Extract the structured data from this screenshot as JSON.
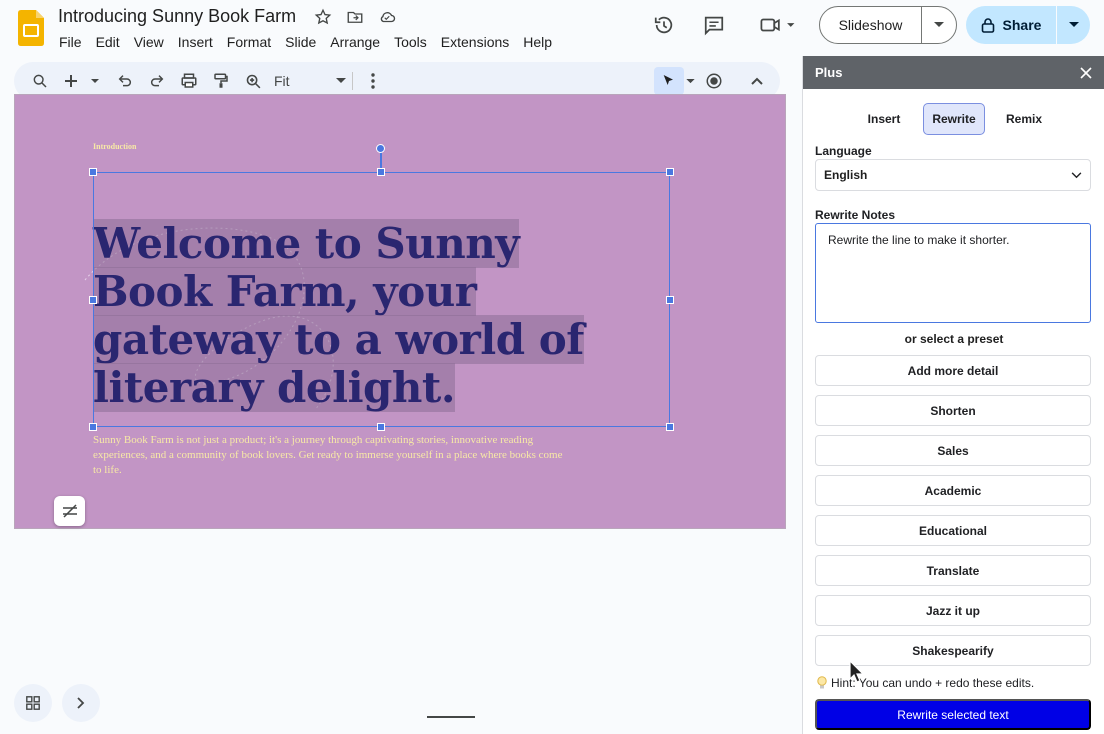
{
  "doc": {
    "title": "Introducing Sunny Book Farm"
  },
  "menu": [
    "File",
    "Edit",
    "View",
    "Insert",
    "Format",
    "Slide",
    "Arrange",
    "Tools",
    "Extensions",
    "Help"
  ],
  "header": {
    "slideshow_label": "Slideshow",
    "share_label": "Share"
  },
  "toolbar": {
    "zoom_value": "Fit"
  },
  "slide": {
    "kicker": "Introduction",
    "heading_lines": [
      "Welcome to Sunny",
      "Book Farm, your",
      "gateway to a world of",
      "literary delight."
    ],
    "body": "Sunny Book Farm is not just a product; it's a journey through captivating stories, innovative reading experiences, and a community of book lovers. Get ready to immerse yourself in a place where books come to life.",
    "bg_color": "#c295c5",
    "heading_color": "#2a2670"
  },
  "panel": {
    "title": "Plus",
    "tabs": [
      "Insert",
      "Rewrite",
      "Remix"
    ],
    "active_tab": "Rewrite",
    "language_label": "Language",
    "language_value": "English",
    "notes_label": "Rewrite Notes",
    "notes_value": "Rewrite the line to make it shorter.",
    "preset_label": "or select a preset",
    "presets": [
      "Add more detail",
      "Shorten",
      "Sales",
      "Academic",
      "Educational",
      "Translate",
      "Jazz it up",
      "Shakespearify"
    ],
    "hint": "Hint: You can undo + redo these edits.",
    "submit_label": "Rewrite selected text",
    "submit_color": "#0000e6"
  }
}
